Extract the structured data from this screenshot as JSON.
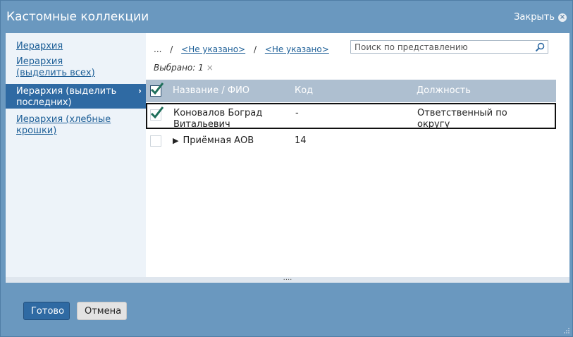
{
  "dialog": {
    "title": "Кастомные коллекции",
    "close_label": "Закрыть"
  },
  "sidebar": {
    "items": [
      {
        "label": "Иерархия",
        "active": false
      },
      {
        "label": "Иерархия (выделить всех)",
        "active": false
      },
      {
        "label": "Иерархия (выделить последних)",
        "active": true
      },
      {
        "label": "Иерархия (хлебные крошки)",
        "active": false
      }
    ]
  },
  "breadcrumb": {
    "root": "...",
    "separator": "/",
    "items": [
      "<Не указано>",
      "<Не указано>"
    ]
  },
  "search": {
    "placeholder": "Поиск по представлению"
  },
  "selection": {
    "label": "Выбрано: 1"
  },
  "grid": {
    "columns": [
      "Название / ФИО",
      "Код",
      "Должность"
    ],
    "rows": [
      {
        "checked": true,
        "name": "Коновалов Боград Витальевич",
        "code": "-",
        "position": "Ответственный по округу",
        "expandable": false
      },
      {
        "checked": false,
        "name": "Приёмная АОВ",
        "code": "14",
        "position": "",
        "expandable": true
      }
    ]
  },
  "footer": {
    "ok_label": "Готово",
    "cancel_label": "Отмена"
  },
  "colors": {
    "dialog_bg": "#6a98bf",
    "accent": "#2f6aa3",
    "header_bg": "#aebfd0",
    "check": "#1f6f5a"
  }
}
